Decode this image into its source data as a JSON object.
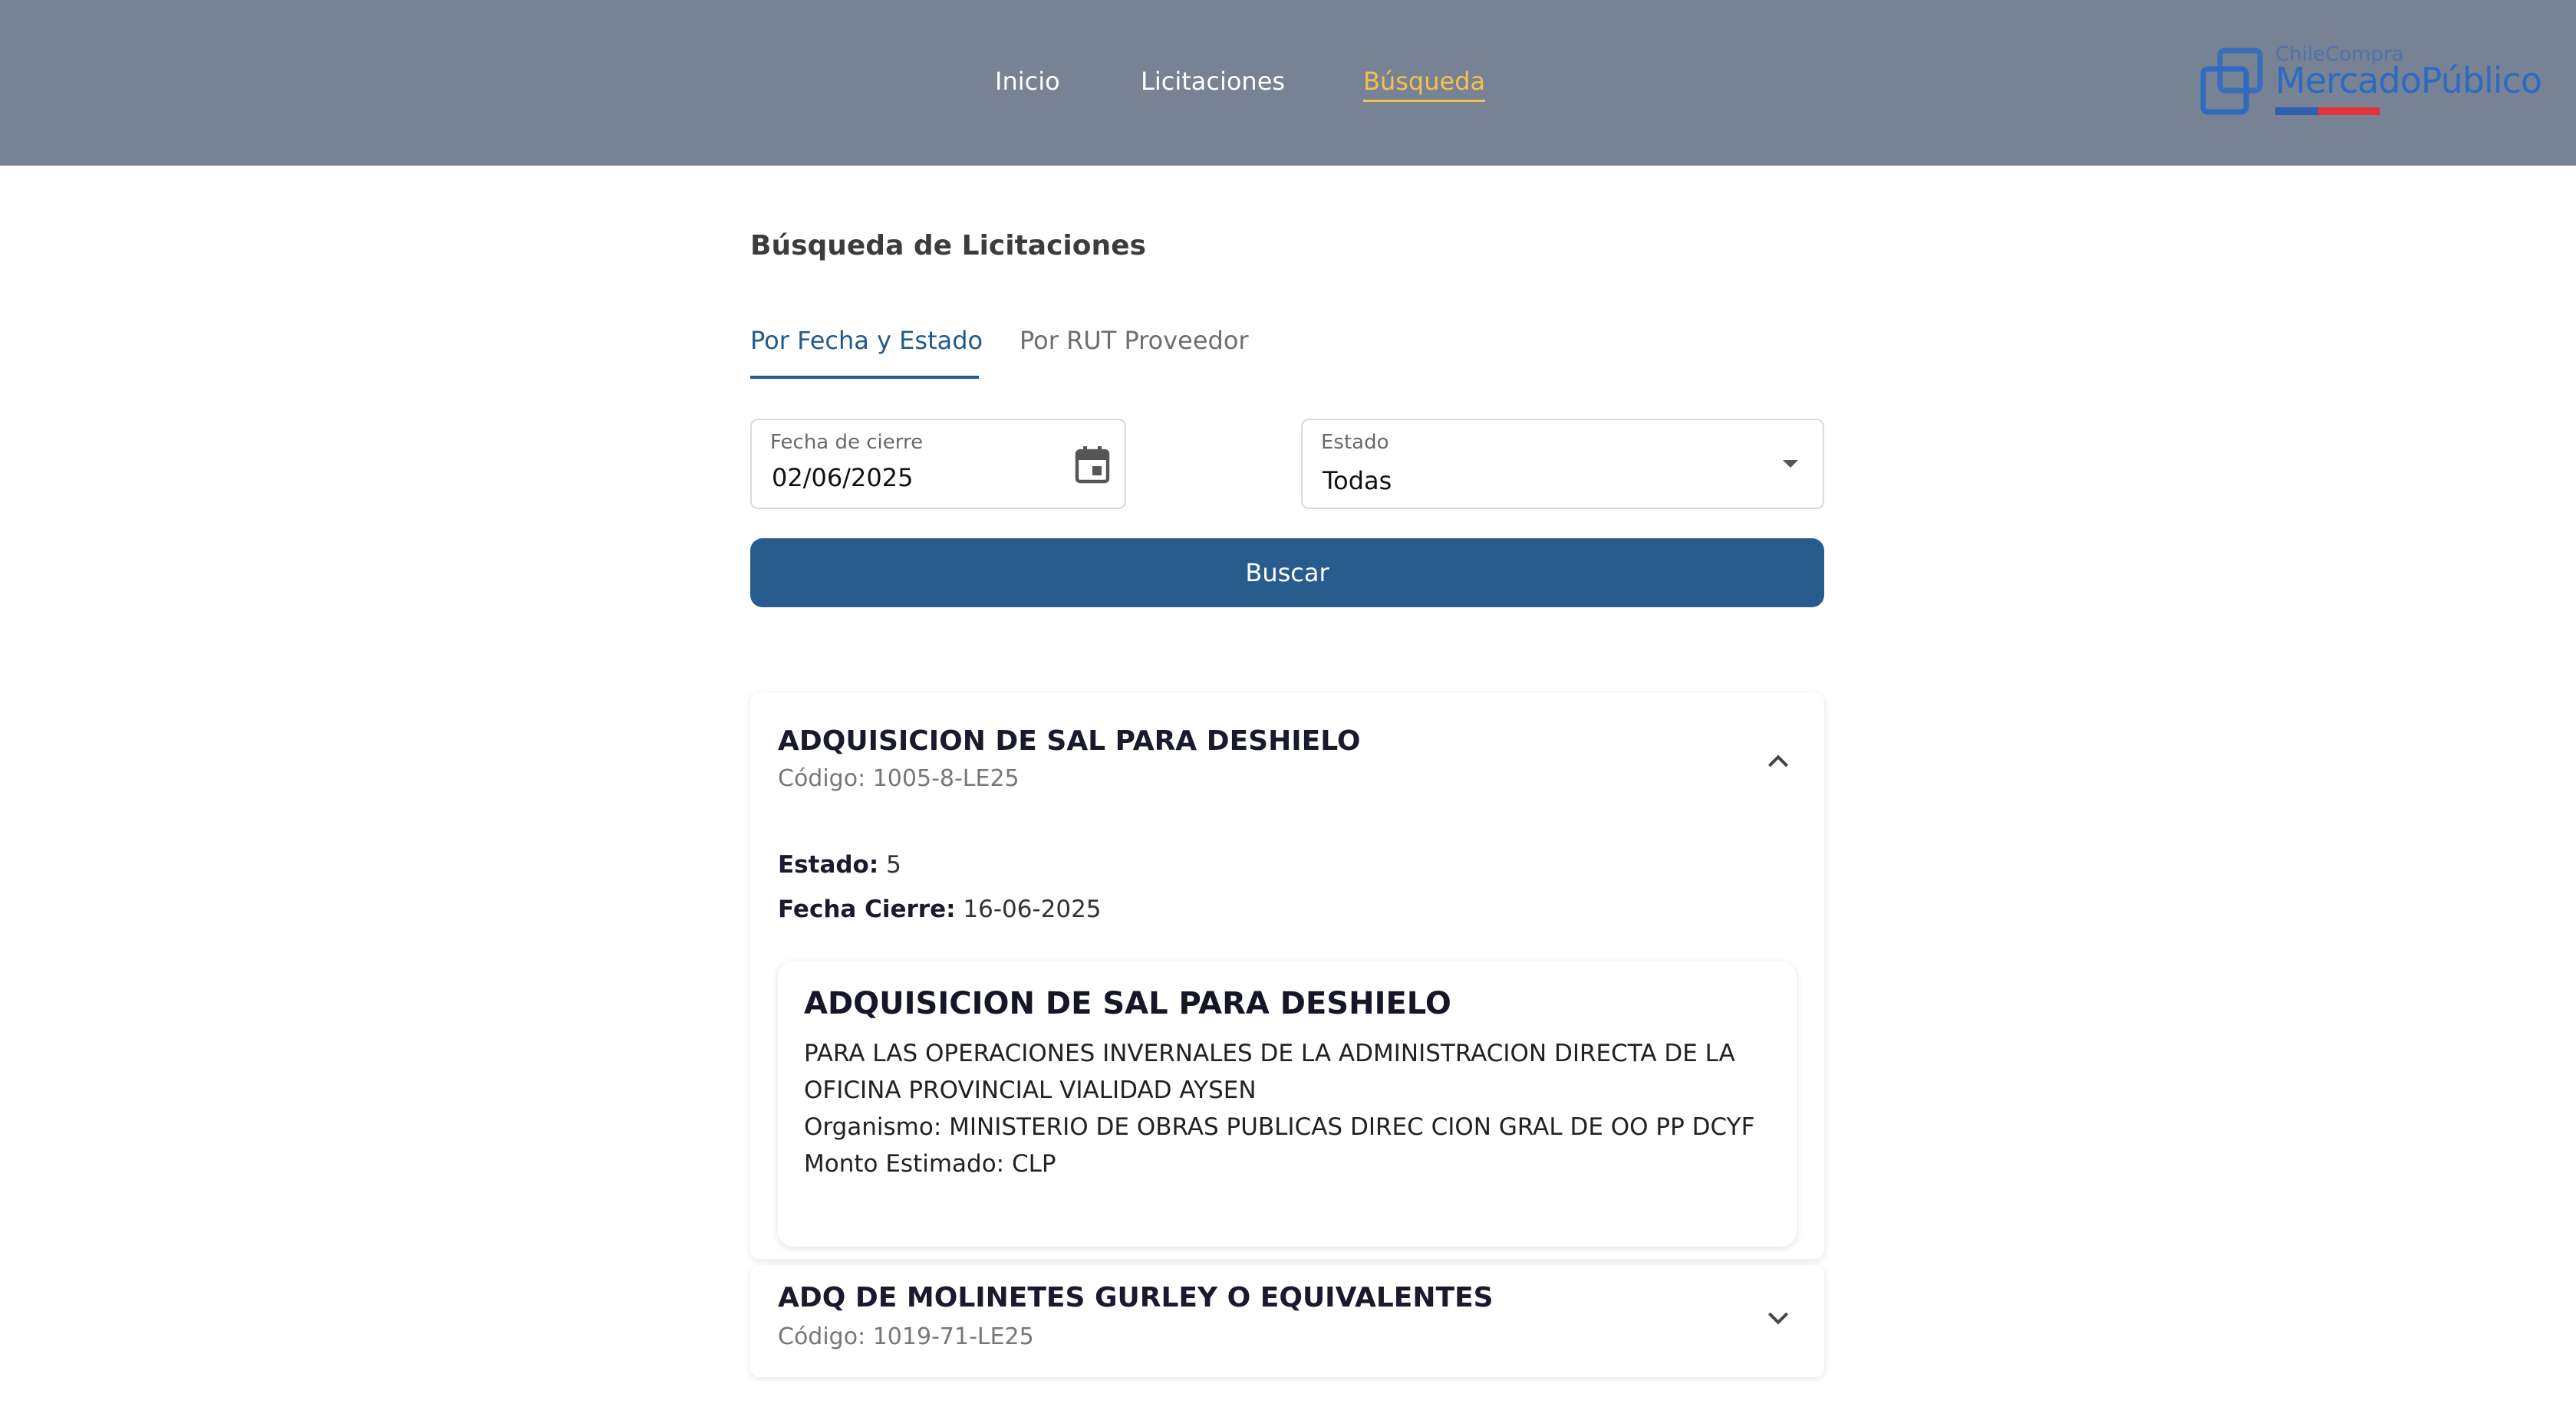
{
  "nav": {
    "items": [
      {
        "label": "Inicio"
      },
      {
        "label": "Licitaciones"
      },
      {
        "label": "Búsqueda"
      }
    ]
  },
  "logo": {
    "small_text": "ChileCompra",
    "big_text": "MercadoPúblico"
  },
  "page": {
    "title": "Búsqueda de Licitaciones"
  },
  "tabs": [
    {
      "label": "Por Fecha y Estado"
    },
    {
      "label": "Por RUT Proveedor"
    }
  ],
  "form": {
    "fecha_label": "Fecha de cierre",
    "fecha_value": "02/06/2025",
    "estado_label": "Estado",
    "estado_value": "Todas",
    "search_button": "Buscar"
  },
  "results": [
    {
      "title": "ADQUISICION DE SAL PARA DESHIELO",
      "code": "Código: 1005-8-LE25",
      "estado_label": "Estado:",
      "estado_value": "5",
      "fecha_label": "Fecha Cierre:",
      "fecha_value": "16-06-2025",
      "detail": {
        "title": "ADQUISICION DE SAL PARA DESHIELO",
        "description": "PARA LAS OPERACIONES INVERNALES DE LA ADMINISTRACION DIRECTA DE LA OFICINA PROVINCIAL VIALIDAD AYSEN",
        "organismo": "Organismo: MINISTERIO DE OBRAS PUBLICAS DIREC CION GRAL DE OO PP DCYF",
        "monto": "Monto Estimado: CLP"
      }
    },
    {
      "title": "ADQ DE MOLINETES GURLEY O EQUIVALENTES",
      "code": "Código: 1019-71-LE25"
    }
  ],
  "colors": {
    "header_bg": "#778294",
    "active_nav": "#f2c14e",
    "primary": "#285c8e"
  }
}
